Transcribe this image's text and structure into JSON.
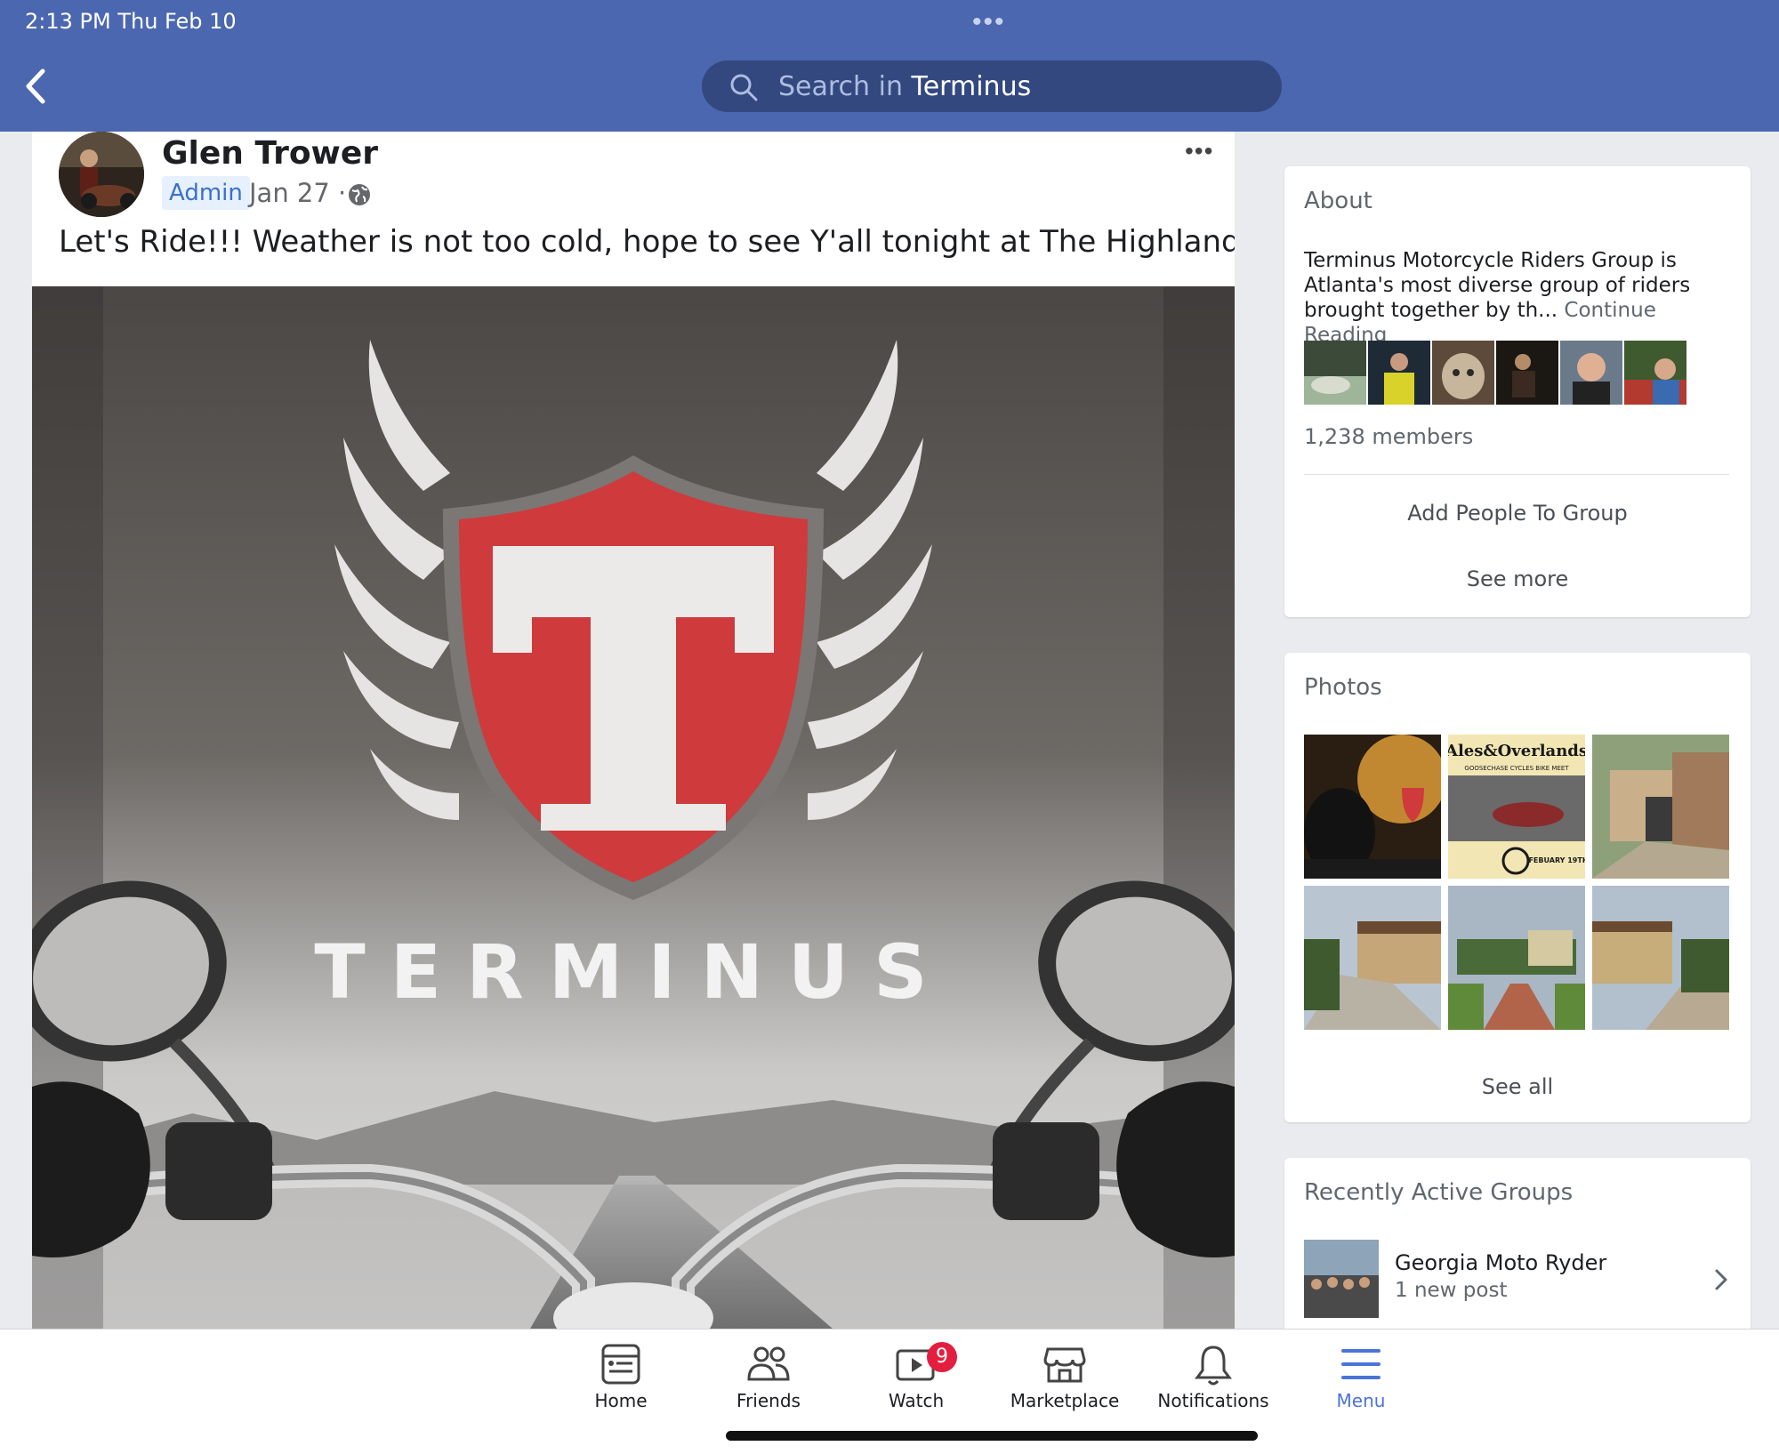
{
  "status_bar": {
    "time": "2:13 PM   Thu Feb 10"
  },
  "search": {
    "prefix": "Search in ",
    "group": "Terminus"
  },
  "post": {
    "author": "Glen Trower",
    "role": "Admin",
    "date": "Jan 27 ·",
    "text": "Let's Ride!!! Weather is not too cold, hope to see Y'all tonight at The Highlander!",
    "image_text": "TERMINUS"
  },
  "about": {
    "title": "About",
    "description": "Terminus Motorcycle Riders Group is Atlanta's most diverse group of riders brought together by th...",
    "continue": "Continue Reading",
    "members_count": "1,238 members",
    "add_people": "Add People To Group",
    "see_more": "See more"
  },
  "photos": {
    "title": "Photos",
    "see_all": "See all",
    "photo2_title": "Ales&Overlands",
    "photo2_subtitle": "GOOSECHASE CYCLES BIKE MEET",
    "photo2_date": "FEBUARY 19TH"
  },
  "recent": {
    "title": "Recently Active Groups",
    "group_name": "Georgia Moto Ryder",
    "group_sub": "1 new post"
  },
  "tabs": {
    "home": "Home",
    "friends": "Friends",
    "watch": "Watch",
    "watch_badge": "9",
    "marketplace": "Marketplace",
    "notifications": "Notifications",
    "menu": "Menu"
  }
}
